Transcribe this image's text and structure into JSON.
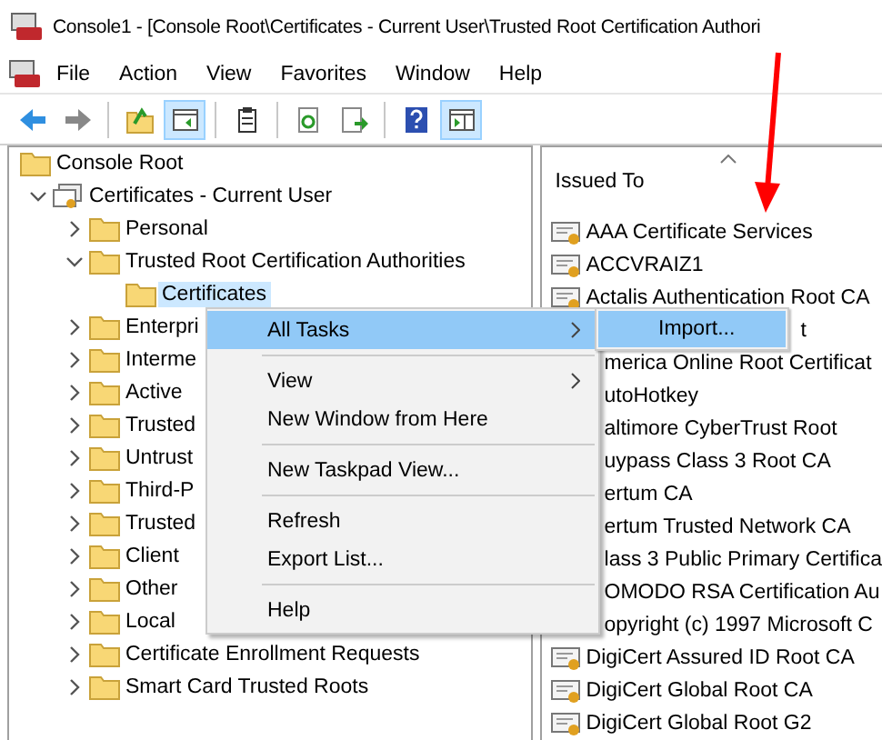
{
  "window": {
    "title": "Console1 - [Console Root\\Certificates - Current User\\Trusted Root Certification Authori"
  },
  "menu_bar": [
    "File",
    "Action",
    "View",
    "Favorites",
    "Window",
    "Help"
  ],
  "toolbar": [
    {
      "kind": "back",
      "pressed": false
    },
    {
      "kind": "forward",
      "pressed": false
    },
    {
      "kind": "sep"
    },
    {
      "kind": "up",
      "pressed": false
    },
    {
      "kind": "tree",
      "pressed": true
    },
    {
      "kind": "sep"
    },
    {
      "kind": "clipboard",
      "pressed": false
    },
    {
      "kind": "sep"
    },
    {
      "kind": "refresh",
      "pressed": false
    },
    {
      "kind": "export",
      "pressed": false
    },
    {
      "kind": "sep"
    },
    {
      "kind": "help",
      "pressed": false
    },
    {
      "kind": "actionpane",
      "pressed": true
    }
  ],
  "tree": [
    {
      "label": "Console Root",
      "selected": false,
      "children": [
        {
          "label": "Certificates - Current User",
          "expanded": true,
          "selected": false,
          "children": [
            {
              "label": "Personal",
              "expanded": false,
              "selected": false
            },
            {
              "label": "Trusted Root Certification Authorities",
              "expanded": true,
              "selected": false,
              "children": [
                {
                  "label": "Certificates",
                  "selected": true
                }
              ]
            },
            {
              "label": "Enterpri",
              "expanded": false,
              "selected": false
            },
            {
              "label": "Interme",
              "expanded": false,
              "selected": false
            },
            {
              "label": "Active",
              "expanded": false,
              "selected": false
            },
            {
              "label": "Trusted",
              "expanded": false,
              "selected": false
            },
            {
              "label": "Untrust",
              "expanded": false,
              "selected": false
            },
            {
              "label": "Third-P",
              "expanded": false,
              "selected": false
            },
            {
              "label": "Trusted",
              "expanded": false,
              "selected": false
            },
            {
              "label": "Client",
              "expanded": false,
              "selected": false
            },
            {
              "label": "Other",
              "expanded": false,
              "selected": false
            },
            {
              "label": "Local",
              "expanded": false,
              "selected": false
            },
            {
              "label": "Certificate Enrollment Requests",
              "expanded": false,
              "selected": false
            },
            {
              "label": "Smart Card Trusted Roots",
              "expanded": false,
              "selected": false
            }
          ]
        }
      ]
    }
  ],
  "list": {
    "column": "Issued To",
    "rows": [
      {
        "text": "AAA Certificate Services",
        "kind": "full"
      },
      {
        "text": "ACCVRAIZ1",
        "kind": "full"
      },
      {
        "text": "Actalis Authentication Root CA",
        "kind": "full"
      },
      {
        "text": "t",
        "kind": "behind-submenu"
      },
      {
        "text": "merica Online Root Certificat",
        "kind": "behind-menu"
      },
      {
        "text": "utoHotkey",
        "kind": "behind-menu"
      },
      {
        "text": "altimore CyberTrust Root",
        "kind": "behind-menu"
      },
      {
        "text": "uypass Class 3 Root CA",
        "kind": "behind-menu"
      },
      {
        "text": "ertum CA",
        "kind": "behind-menu"
      },
      {
        "text": "ertum Trusted Network CA",
        "kind": "behind-menu"
      },
      {
        "text": "lass 3 Public Primary Certifica",
        "kind": "behind-menu"
      },
      {
        "text": "OMODO RSA Certification Au",
        "kind": "behind-menu"
      },
      {
        "text": "opyright (c) 1997 Microsoft C",
        "kind": "behind-menu"
      },
      {
        "text": "DigiCert Assured ID Root CA",
        "kind": "full"
      },
      {
        "text": "DigiCert Global Root CA",
        "kind": "full"
      },
      {
        "text": "DigiCert Global Root G2",
        "kind": "full"
      }
    ]
  },
  "context_menu": [
    {
      "kind": "item",
      "label": "All Tasks",
      "submenu": true,
      "selected": true
    },
    {
      "kind": "separator"
    },
    {
      "kind": "item",
      "label": "View",
      "submenu": true,
      "selected": false
    },
    {
      "kind": "item",
      "label": "New Window from Here",
      "submenu": false,
      "selected": false
    },
    {
      "kind": "separator"
    },
    {
      "kind": "item",
      "label": "New Taskpad View...",
      "submenu": false,
      "selected": false
    },
    {
      "kind": "separator"
    },
    {
      "kind": "item",
      "label": "Refresh",
      "submenu": false,
      "selected": false
    },
    {
      "kind": "item",
      "label": "Export List...",
      "submenu": false,
      "selected": false
    },
    {
      "kind": "separator"
    },
    {
      "kind": "item",
      "label": "Help",
      "submenu": false,
      "selected": false
    }
  ],
  "submenu": [
    {
      "label": "Import...",
      "selected": true
    }
  ]
}
